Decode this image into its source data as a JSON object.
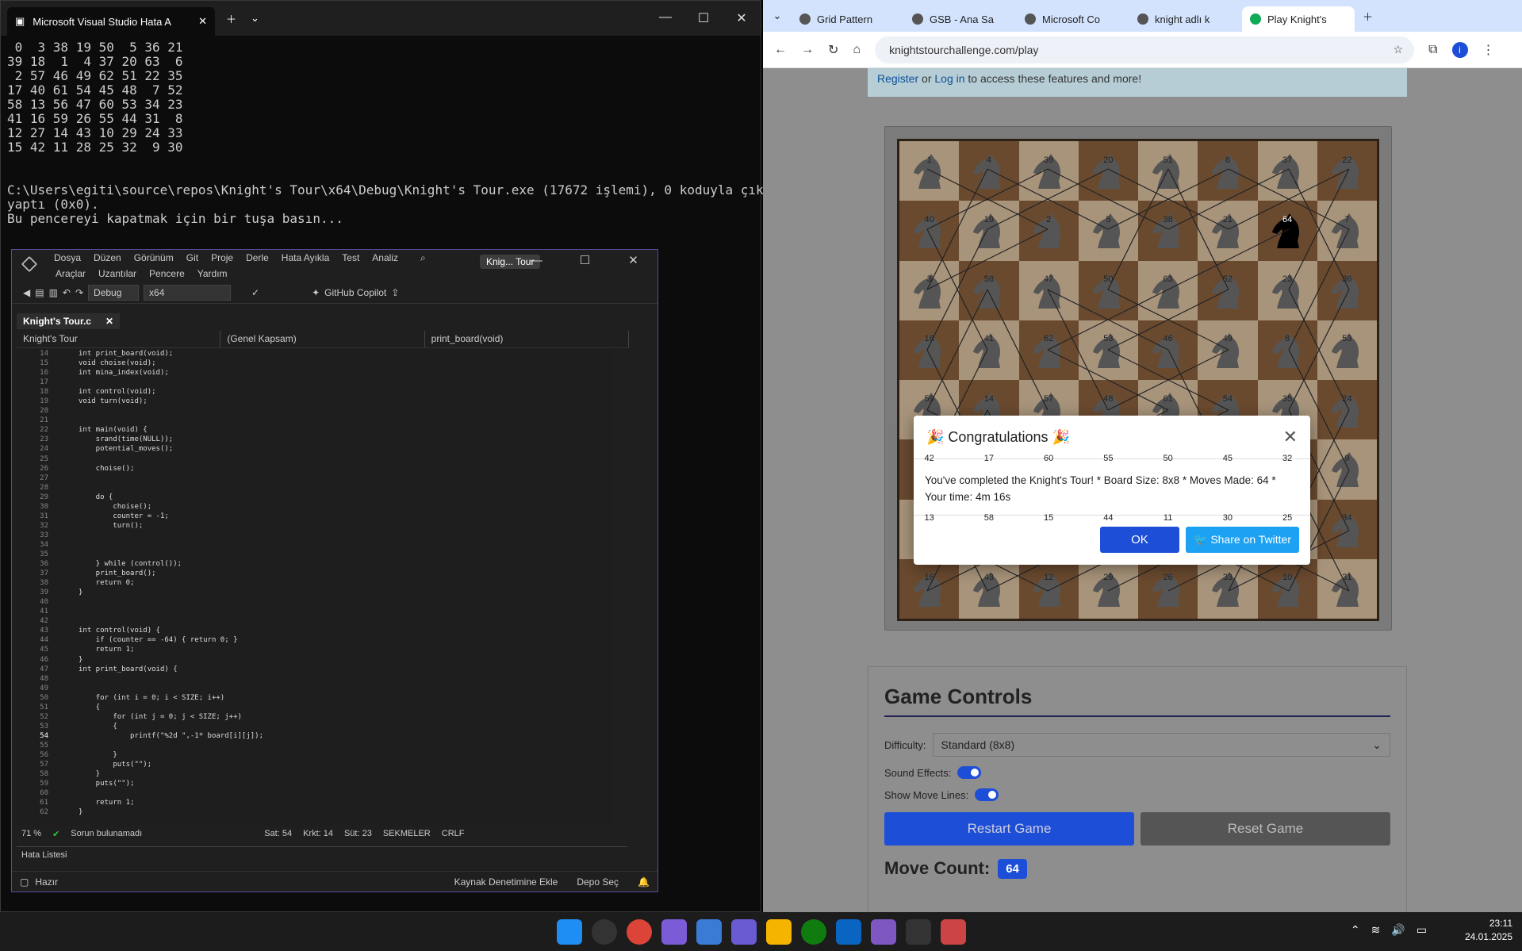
{
  "terminal": {
    "tab_title": "Microsoft Visual Studio Hata A",
    "output": " 0  3 38 19 50  5 36 21\n39 18  1  4 37 20 63  6\n 2 57 46 49 62 51 22 35\n17 40 61 54 45 48  7 52\n58 13 56 47 60 53 34 23\n41 16 59 26 55 44 31  8\n12 27 14 43 10 29 24 33\n15 42 11 28 25 32  9 30\n\n\nC:\\Users\\egiti\\source\\repos\\Knight's Tour\\x64\\Debug\\Knight's Tour.exe (17672 işlemi), 0 koduyla çıkış\nyaptı (0x0).\nBu pencereyi kapatmak için bir tuşa basın..."
  },
  "vs": {
    "menu": [
      "Dosya",
      "Düzen",
      "Görünüm",
      "Git",
      "Proje",
      "Derle",
      "Hata Ayıkla",
      "Test",
      "Analiz",
      "Araçlar",
      "Uzantılar",
      "Pencere",
      "Yardım"
    ],
    "project_badge": "Knig... Tour",
    "config": "Debug",
    "platform": "x64",
    "copilot": "GitHub Copilot",
    "doc_tab": "Knight's Tour.c",
    "nav": {
      "project": "Knight's Tour",
      "scope": "(Genel Kapsam)",
      "func": "print_board(void)"
    },
    "code_lines": [
      {
        "n": "14",
        "t": "int print_board(void);"
      },
      {
        "n": "15",
        "t": "void choise(void);"
      },
      {
        "n": "16",
        "t": "int mina_index(void);"
      },
      {
        "n": "17",
        "t": ""
      },
      {
        "n": "18",
        "t": "int control(void);"
      },
      {
        "n": "19",
        "t": "void turn(void);"
      },
      {
        "n": "20",
        "t": ""
      },
      {
        "n": "21",
        "t": ""
      },
      {
        "n": "22",
        "t": "int main(void) {"
      },
      {
        "n": "23",
        "t": "    srand(time(NULL));"
      },
      {
        "n": "24",
        "t": "    potential_moves();"
      },
      {
        "n": "25",
        "t": ""
      },
      {
        "n": "26",
        "t": "    choise();"
      },
      {
        "n": "27",
        "t": ""
      },
      {
        "n": "28",
        "t": ""
      },
      {
        "n": "29",
        "t": "    do {"
      },
      {
        "n": "30",
        "t": "        choise();"
      },
      {
        "n": "31",
        "t": "        counter = -1;"
      },
      {
        "n": "32",
        "t": "        turn();"
      },
      {
        "n": "33",
        "t": ""
      },
      {
        "n": "34",
        "t": ""
      },
      {
        "n": "35",
        "t": ""
      },
      {
        "n": "36",
        "t": "    } while (control());"
      },
      {
        "n": "37",
        "t": "    print_board();"
      },
      {
        "n": "38",
        "t": "    return 0;"
      },
      {
        "n": "39",
        "t": "}"
      },
      {
        "n": "40",
        "t": ""
      },
      {
        "n": "41",
        "t": ""
      },
      {
        "n": "42",
        "t": ""
      },
      {
        "n": "43",
        "t": "int control(void) {"
      },
      {
        "n": "44",
        "t": "    if (counter == -64) { return 0; }"
      },
      {
        "n": "45",
        "t": "    return 1;"
      },
      {
        "n": "46",
        "t": "}"
      },
      {
        "n": "47",
        "t": "int print_board(void) {"
      },
      {
        "n": "48",
        "t": ""
      },
      {
        "n": "49",
        "t": ""
      },
      {
        "n": "50",
        "t": "    for (int i = 0; i < SIZE; i++)"
      },
      {
        "n": "51",
        "t": "    {"
      },
      {
        "n": "52",
        "t": "        for (int j = 0; j < SIZE; j++)"
      },
      {
        "n": "53",
        "t": "        {"
      },
      {
        "n": "54",
        "t": "            printf(\"%2d \",-1* board[i][j]);"
      },
      {
        "n": "55",
        "t": ""
      },
      {
        "n": "56",
        "t": "        }"
      },
      {
        "n": "57",
        "t": "        puts(\"\");"
      },
      {
        "n": "58",
        "t": "    }"
      },
      {
        "n": "59",
        "t": "    puts(\"\");"
      },
      {
        "n": "60",
        "t": ""
      },
      {
        "n": "61",
        "t": "    return 1;"
      },
      {
        "n": "62",
        "t": "}"
      }
    ],
    "zoom": "71 %",
    "issues": "Sorun bulunamadı",
    "line": "Sat: 54",
    "char": "Krkt: 14",
    "col": "Süt: 23",
    "tabs": "SEKMELER",
    "eol": "CRLF",
    "error_panel": "Hata Listesi",
    "status_ready": "Hazır",
    "source_control": "Kaynak Denetimine Ekle",
    "repo": "Depo Seç"
  },
  "browser": {
    "tabs": [
      "Grid Pattern",
      "GSB - Ana Sa",
      "Microsoft Co",
      "knight adlı k",
      "Play Knight's"
    ],
    "url": "knightstourchallenge.com/play",
    "notice": {
      "register": "Register",
      "or": " or ",
      "login": "Log in",
      "rest": " to access these features and more!"
    },
    "board": [
      [
        1,
        4,
        39,
        20,
        51,
        6,
        37,
        22
      ],
      [
        40,
        19,
        2,
        5,
        38,
        21,
        64,
        7
      ],
      [
        3,
        58,
        47,
        50,
        63,
        52,
        23,
        36
      ],
      [
        18,
        41,
        62,
        53,
        46,
        49,
        8,
        53
      ],
      [
        59,
        14,
        57,
        48,
        61,
        54,
        35,
        24
      ],
      [
        42,
        17,
        60,
        55,
        50,
        45,
        32,
        9
      ],
      [
        13,
        58,
        15,
        44,
        11,
        30,
        25,
        34
      ],
      [
        16,
        43,
        12,
        29,
        26,
        33,
        10,
        31
      ]
    ],
    "modal": {
      "title": "🎉 Congratulations 🎉",
      "body": "You've completed the Knight's Tour! * Board Size: 8x8 * Moves Made: 64 * Your time: 4m 16s",
      "ok": "OK",
      "share": "Share on Twitter"
    },
    "controls": {
      "title": "Game Controls",
      "difficulty_label": "Difficulty:",
      "difficulty": "Standard (8x8)",
      "sound": "Sound Effects:",
      "lines": "Show Move Lines:",
      "restart": "Restart Game",
      "reset": "Reset Game",
      "move_count_label": "Move Count:",
      "move_count": "64"
    }
  },
  "taskbar": {
    "time": "23:11",
    "date": "24.01.2025"
  }
}
